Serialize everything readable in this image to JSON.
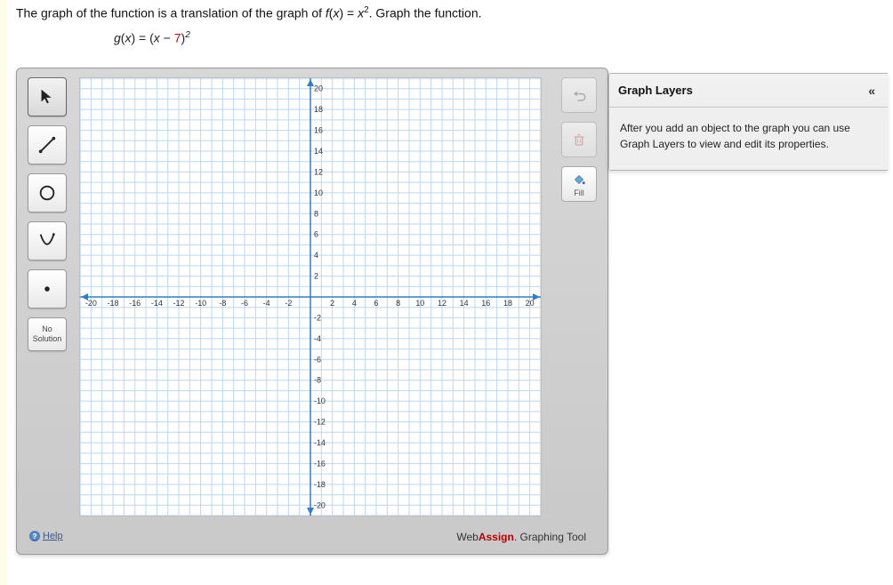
{
  "question": {
    "prompt_html": "The graph of the function is a translation of the graph of f(x) = x². Graph the function.",
    "equation_prefix": "g(x) = (x − ",
    "equation_highlight": "7",
    "equation_suffix": ")²"
  },
  "tools": {
    "pointer": "Pointer",
    "line": "Line",
    "circle": "Circle",
    "parabola": "Parabola",
    "point": "Point",
    "no_solution_line1": "No",
    "no_solution_line2": "Solution"
  },
  "right_tools": {
    "undo": "",
    "delete": "",
    "fill": "Fill"
  },
  "help_label": "Help",
  "brand_prefix": "Web",
  "brand_bold": "Assign",
  "brand_suffix": ". Graphing Tool",
  "layers": {
    "title": "Graph Layers",
    "collapse": "«",
    "body": "After you add an object to the graph you can use Graph Layers to view and edit its properties."
  },
  "chart_data": {
    "type": "coordinate-grid",
    "xlim": [
      -21,
      21
    ],
    "ylim": [
      -21,
      21
    ],
    "x_ticks": [
      -20,
      -18,
      -16,
      -14,
      -12,
      -10,
      -8,
      -6,
      -4,
      -2,
      2,
      4,
      6,
      8,
      10,
      12,
      14,
      16,
      18,
      20
    ],
    "y_ticks": [
      -20,
      -18,
      -16,
      -14,
      -12,
      -10,
      -8,
      -6,
      -4,
      -2,
      2,
      4,
      6,
      8,
      10,
      12,
      14,
      16,
      18,
      20
    ],
    "grid_step": 1,
    "title": "",
    "xlabel": "",
    "ylabel": "",
    "series": []
  }
}
